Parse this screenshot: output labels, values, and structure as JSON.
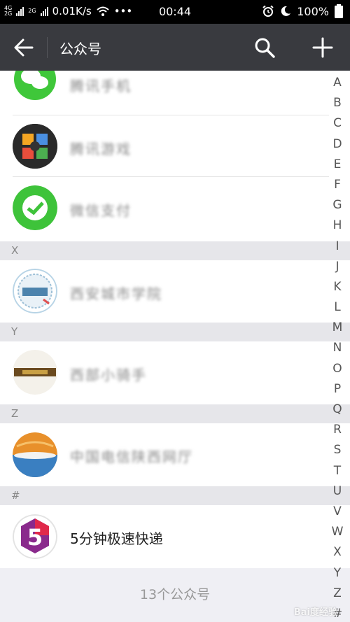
{
  "status_bar": {
    "net1": "4G",
    "net2": "2G",
    "net3": "2G",
    "speed": "0.01K/s",
    "dots": "•••",
    "time": "00:44",
    "battery": "100%",
    "icons": [
      "signal-icon",
      "wifi-icon",
      "alarm-icon",
      "moon-icon",
      "battery-icon"
    ]
  },
  "header": {
    "title": "公众号",
    "icons": [
      "back-arrow-icon",
      "search-icon",
      "plus-icon"
    ]
  },
  "list": {
    "rows": [
      {
        "name": "腾讯手机",
        "avatar": "wechat-green-icon"
      },
      {
        "name": "腾讯游戏",
        "avatar": "colorful-game-icon"
      },
      {
        "name": "微信支付",
        "avatar": "green-chat-icon"
      },
      {
        "name": "西安城市学院",
        "avatar": "university-seal-icon"
      },
      {
        "name": "西部小骑手",
        "avatar": "brown-bar-icon"
      },
      {
        "name": "中国电信陕西网厅",
        "avatar": "orange-blue-logo-icon"
      },
      {
        "name": "5分钟极速快递",
        "avatar": "number-5-logo-icon"
      }
    ],
    "sections": [
      "X",
      "Y",
      "Z",
      "#"
    ],
    "footer": "13个公众号"
  },
  "index_bar": [
    "A",
    "B",
    "C",
    "D",
    "E",
    "F",
    "G",
    "H",
    "I",
    "J",
    "K",
    "L",
    "M",
    "N",
    "O",
    "P",
    "Q",
    "R",
    "S",
    "T",
    "U",
    "V",
    "W",
    "X",
    "Y",
    "Z",
    "#"
  ],
  "watermark": "Bai度经验",
  "colors": {
    "appbar": "#393a3f",
    "section_bg": "#e6e6ea",
    "page_bg": "#efeff4"
  }
}
